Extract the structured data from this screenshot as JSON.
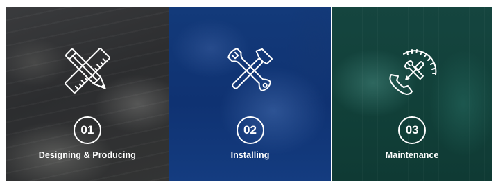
{
  "services": [
    {
      "number": "01",
      "title": "Designing & Producing",
      "icon": "pencil-ruler-icon",
      "color": "#2f3032"
    },
    {
      "number": "02",
      "title": "Installing",
      "icon": "hammer-wrench-icon",
      "color": "#103676"
    },
    {
      "number": "03",
      "title": "Maintenance",
      "icon": "phone-tools-gauge-icon",
      "color": "#124239"
    }
  ]
}
